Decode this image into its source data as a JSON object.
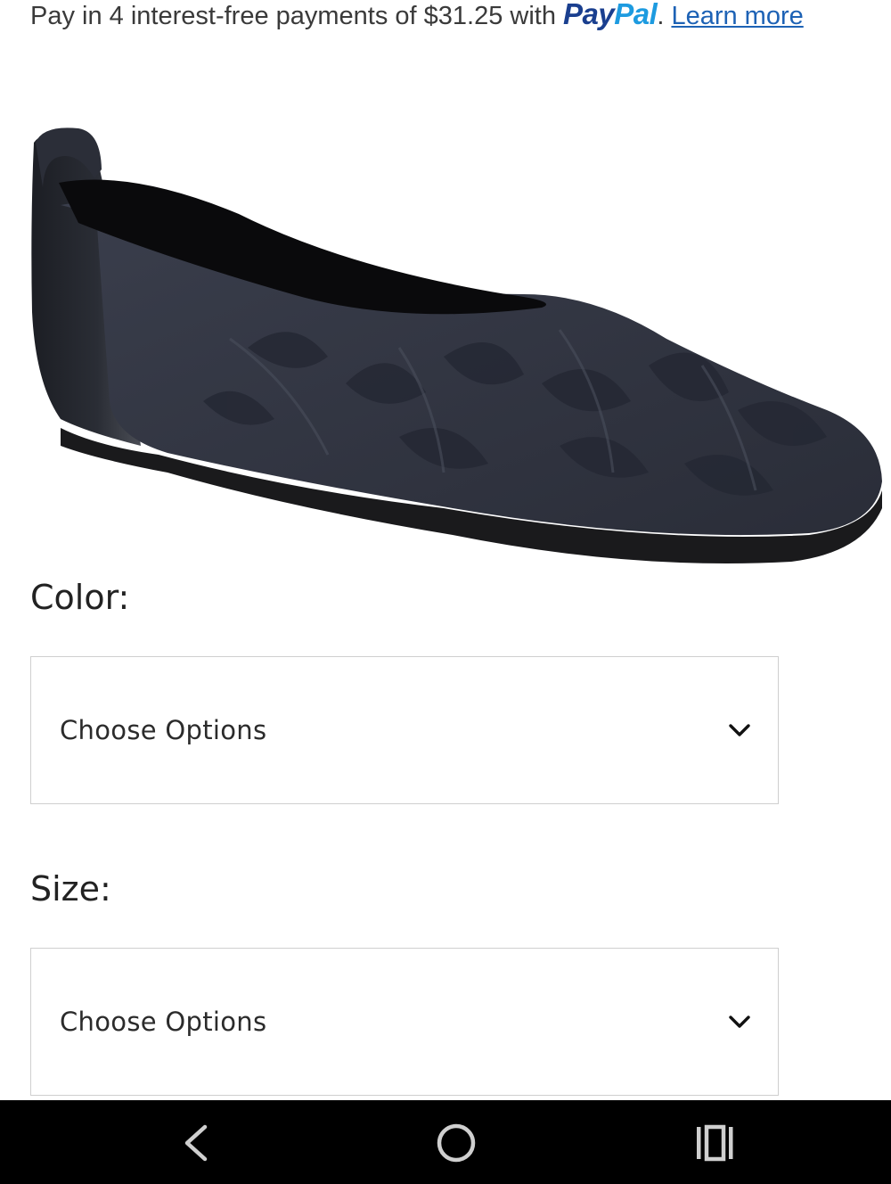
{
  "paypal": {
    "prefix": "Pay in 4 interest-free payments of $31.25 with ",
    "logo_pay": "Pay",
    "logo_pal": "Pal",
    "separator": ".",
    "learn_more": "Learn more"
  },
  "product": {
    "image_icon": "shoe-image"
  },
  "color": {
    "label": "Color:",
    "selected": "Choose Options"
  },
  "size": {
    "label": "Size:",
    "selected": "Choose Options"
  },
  "nav": {
    "back_icon": "back-chevron-icon",
    "home_icon": "home-circle-icon",
    "recents_icon": "recents-icon"
  },
  "colors": {
    "paypal_dark": "#1a3f8f",
    "paypal_light": "#1d9be0",
    "link": "#1d62b5",
    "nav_bar": "#000000"
  }
}
